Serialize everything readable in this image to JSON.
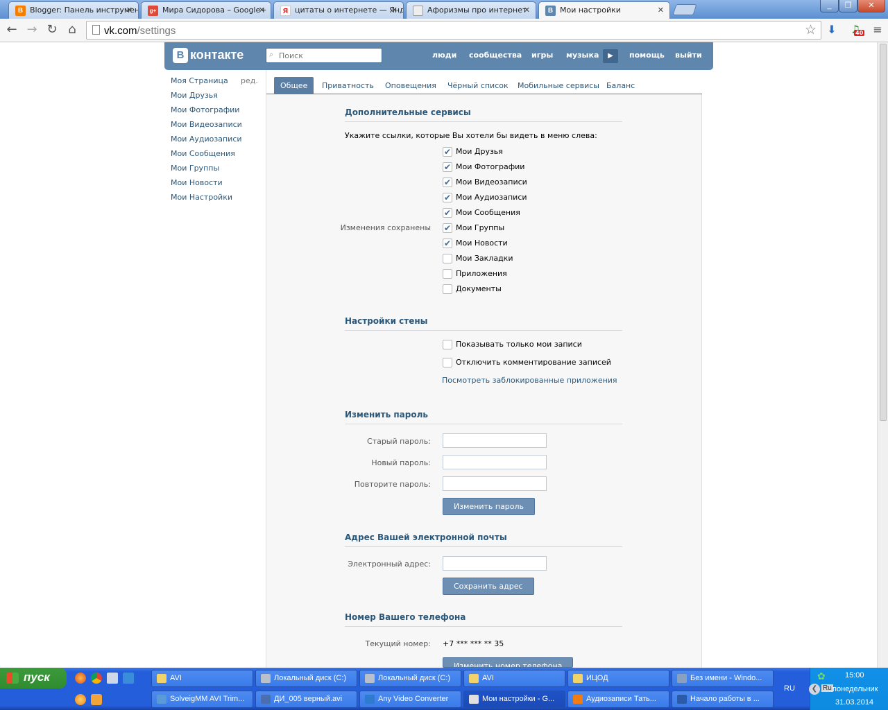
{
  "browser": {
    "tabs": [
      {
        "title": "Blogger: Панель инструмен",
        "icon": "blogger-icon",
        "color": "#f57d00",
        "glyph": "B"
      },
      {
        "title": "Мира Сидорова – Google+",
        "icon": "google-plus-icon",
        "color": "#dd4b39",
        "glyph": "g+"
      },
      {
        "title": "цитаты о интернете — Янд",
        "icon": "yandex-icon",
        "color": "#ff0000",
        "glyph": "Я"
      },
      {
        "title": "Афоризмы про интернет",
        "icon": "book-icon",
        "color": "#999999",
        "glyph": ""
      },
      {
        "title": "Мои настройки",
        "icon": "vk-icon",
        "color": "#5f86ad",
        "glyph": "B"
      }
    ],
    "url_host": "vk.com",
    "url_path": "/settings",
    "download_badge": "40"
  },
  "vk": {
    "logo_letter": "B",
    "logo_text": "контакте",
    "search_placeholder": "Поиск",
    "nav": [
      "люди",
      "сообщества",
      "игры",
      "музыка",
      "помощь",
      "выйти"
    ],
    "left_menu": [
      "Моя Страница",
      "Мои Друзья",
      "Мои Фотографии",
      "Мои Видеозаписи",
      "Мои Аудиозаписи",
      "Мои Сообщения",
      "Мои Группы",
      "Мои Новости",
      "Мои Настройки"
    ],
    "left_menu_edit": "ред.",
    "tabs": [
      "Общее",
      "Приватность",
      "Оповещения",
      "Чёрный список",
      "Мобильные сервисы",
      "Баланс"
    ],
    "services": {
      "title": "Дополнительные сервисы",
      "intro": "Укажите ссылки, которые Вы хотели бы видеть в меню слева:",
      "saved_notice": "Изменения сохранены",
      "items": [
        {
          "label": "Мои Друзья",
          "checked": true
        },
        {
          "label": "Мои Фотографии",
          "checked": true
        },
        {
          "label": "Мои Видеозаписи",
          "checked": true
        },
        {
          "label": "Мои Аудиозаписи",
          "checked": true
        },
        {
          "label": "Мои Сообщения",
          "checked": true
        },
        {
          "label": "Мои Группы",
          "checked": true
        },
        {
          "label": "Мои Новости",
          "checked": true
        },
        {
          "label": "Мои Закладки",
          "checked": false
        },
        {
          "label": "Приложения",
          "checked": false
        },
        {
          "label": "Документы",
          "checked": false
        }
      ]
    },
    "wall": {
      "title": "Настройки стены",
      "only_mine": "Показывать только мои записи",
      "disable_comments": "Отключить комментирование записей",
      "blocked_apps_link": "Посмотреть заблокированные приложения"
    },
    "password": {
      "title": "Изменить пароль",
      "old_label": "Старый пароль:",
      "new_label": "Новый пароль:",
      "repeat_label": "Повторите пароль:",
      "button": "Изменить пароль"
    },
    "email": {
      "title": "Адрес Вашей электронной почты",
      "label": "Электронный адрес:",
      "button": "Сохранить адрес"
    },
    "phone": {
      "title": "Номер Вашего телефона",
      "label": "Текущий номер:",
      "value": "+7 *** *** ** 35",
      "button": "Изменить номер телефона"
    }
  },
  "taskbar": {
    "start": "пуск",
    "row1": [
      "AVI",
      "Локальный диск (C:)",
      "Локальный диск (C:)",
      "AVI",
      "ИЦОД",
      "Без имени - Windo..."
    ],
    "row2": [
      "SolveigMM AVI Trim...",
      "ДИ_005 верный.avi",
      "Any Video Converter",
      "Мои настройки - G...",
      "Аудиозаписи Тать...",
      "Начало работы в ..."
    ],
    "lang": "RU",
    "tray_lang": "Ru",
    "time": "15:00",
    "day": "понедельник",
    "date": "31.03.2014"
  }
}
